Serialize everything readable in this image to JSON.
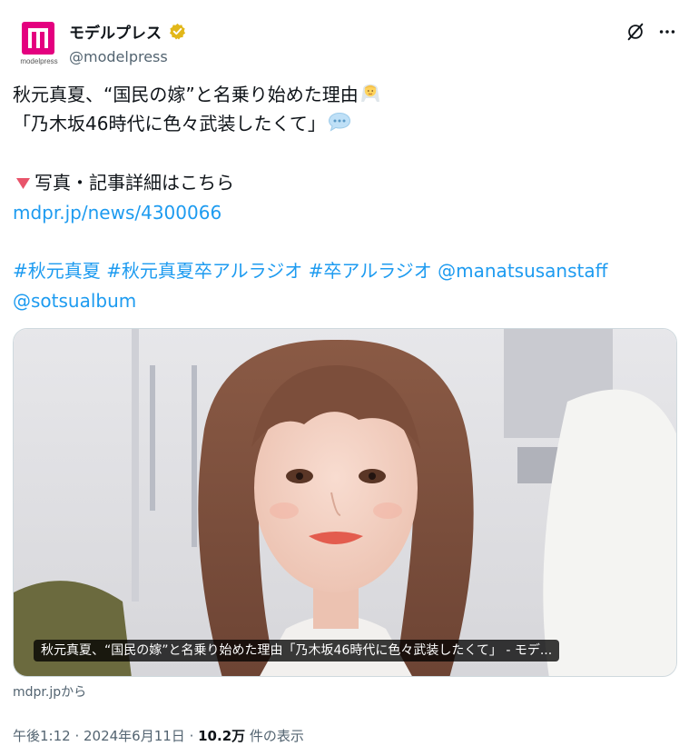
{
  "account": {
    "display_name": "モデルプレス",
    "handle": "@modelpress",
    "avatar_text": "modelpress",
    "verified_color": "#e2b719"
  },
  "tweet": {
    "line1": "秋元真夏、“国民の嫁”と名乗り始めた理由",
    "line1_emoji": "bride-emoji",
    "line2": "「乃木坂46時代に色々武装したくて」",
    "line2_emoji": "speech-bubble-emoji",
    "line3_marker": "▼",
    "line3": "写真・記事詳細はこちら",
    "link": "mdpr.jp/news/4300066",
    "tags_line1": "#秋元真夏 #秋元真夏卒アルラジオ #卒アルラジオ @manatsusanstaff",
    "tags_line2": "@sotsualbum"
  },
  "card": {
    "title": "秋元真夏、“国民の嫁”と名乗り始めた理由「乃木坂46時代に色々武装したくて」 - モデ...",
    "source": "mdpr.jpから"
  },
  "meta": {
    "time": "午後1:12",
    "separator": " · ",
    "date": "2024年6月11日",
    "separator2": " · ",
    "views": "10.2万",
    "views_label": " 件の表示"
  },
  "colors": {
    "link": "#1d9bf0",
    "brand": "#e4007f",
    "muted": "#536471"
  }
}
